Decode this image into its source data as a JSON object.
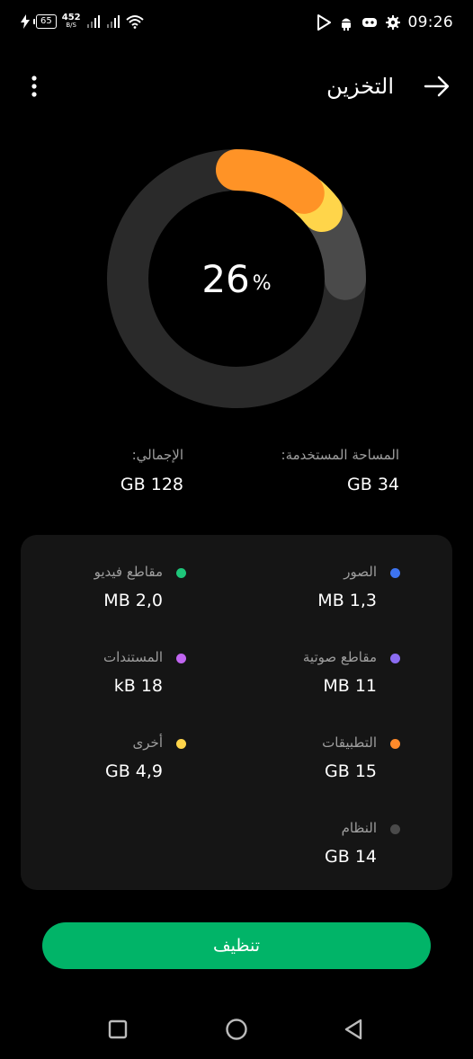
{
  "status_bar": {
    "time": "09:26",
    "battery_level": "65",
    "net_speed_value": "452",
    "net_speed_unit": "B/S",
    "icons": [
      "charging-bolt-icon",
      "battery-icon",
      "signal-icon",
      "signal-icon",
      "wifi-icon",
      "play-store-icon",
      "android-icon",
      "game-controller-icon",
      "settings-gear-icon"
    ]
  },
  "header": {
    "title": "التخزين",
    "back_icon": "arrow-right-icon",
    "menu_icon": "more-vertical-icon"
  },
  "usage": {
    "percent_value": "26",
    "percent_sign": "%",
    "used_label": "المساحة المستخدمة:",
    "used_value": "34 GB",
    "total_label": "الإجمالي:",
    "total_value": "128 GB",
    "track_color": "#2a2a2a"
  },
  "chart_data": {
    "type": "pie",
    "style": "donut",
    "center_label": "26%",
    "used_fraction": 0.26,
    "segments": [
      {
        "name": "التطبيقات",
        "value_gb": 15,
        "color": "#ff9326"
      },
      {
        "name": "أخرى",
        "value_gb": 4.9,
        "color": "#ffd54a"
      },
      {
        "name": "النظام",
        "value_gb": 14,
        "color": "#4a4a4a"
      }
    ]
  },
  "categories": [
    {
      "label": "الصور",
      "value": "1,3 MB",
      "color": "#3d74f0"
    },
    {
      "label": "مقاطع فيديو",
      "value": "2,0 MB",
      "color": "#1ec67a"
    },
    {
      "label": "مقاطع صوتية",
      "value": "11 MB",
      "color": "#8b6cf2"
    },
    {
      "label": "المستندات",
      "value": "18 kB",
      "color": "#c065f0"
    },
    {
      "label": "التطبيقات",
      "value": "15 GB",
      "color": "#ff8a2a"
    },
    {
      "label": "أخرى",
      "value": "4,9 GB",
      "color": "#ffd54a"
    },
    {
      "label": "النظام",
      "value": "14 GB",
      "color": "#4a4a4a"
    }
  ],
  "actions": {
    "clean_label": "تنظيف",
    "clean_color": "#01b468"
  },
  "nav_bar": {
    "icons": [
      "recent-apps-square-icon",
      "home-circle-icon",
      "back-triangle-icon"
    ]
  }
}
